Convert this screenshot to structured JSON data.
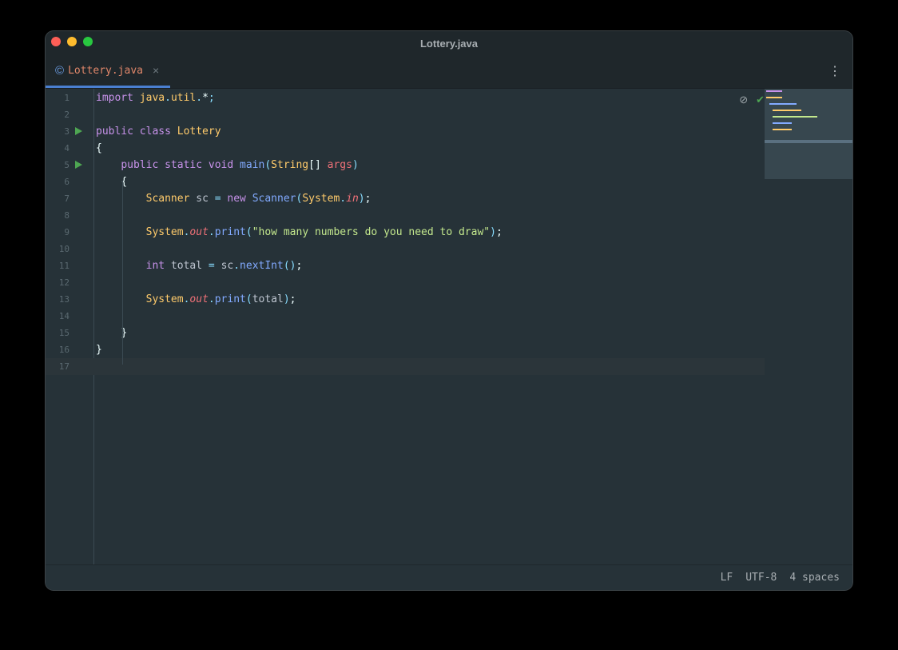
{
  "window": {
    "title": "Lottery.java"
  },
  "tab": {
    "label": "Lottery.java",
    "icon": "class-icon",
    "close": "×",
    "menu": "⋮"
  },
  "lines": [
    {
      "n": "1",
      "t": [
        [
          "kw",
          "import "
        ],
        [
          "cls",
          "java"
        ],
        [
          "pun",
          "."
        ],
        [
          "cls",
          "util"
        ],
        [
          "pun",
          "."
        ],
        [
          "plain",
          "*"
        ],
        [
          "pun",
          ";"
        ]
      ]
    },
    {
      "n": "2",
      "t": []
    },
    {
      "n": "3",
      "run": true,
      "t": [
        [
          "kw",
          "public class "
        ],
        [
          "cls",
          "Lottery"
        ]
      ]
    },
    {
      "n": "4",
      "t": [
        [
          "brk",
          "{"
        ]
      ]
    },
    {
      "n": "5",
      "run": true,
      "t": [
        [
          "plain",
          "    "
        ],
        [
          "kw",
          "public static void "
        ],
        [
          "fn",
          "main"
        ],
        [
          "pun",
          "("
        ],
        [
          "cls",
          "String"
        ],
        [
          "brk",
          "[] "
        ],
        [
          "param",
          "args"
        ],
        [
          "pun",
          ")"
        ]
      ]
    },
    {
      "n": "6",
      "t": [
        [
          "plain",
          "    "
        ],
        [
          "brk",
          "{"
        ]
      ]
    },
    {
      "n": "7",
      "t": [
        [
          "plain",
          "        "
        ],
        [
          "cls",
          "Scanner "
        ],
        [
          "var",
          "sc "
        ],
        [
          "pun",
          "= "
        ],
        [
          "kw",
          "new "
        ],
        [
          "fn",
          "Scanner"
        ],
        [
          "pun",
          "("
        ],
        [
          "cls",
          "System"
        ],
        [
          "pun",
          "."
        ],
        [
          "fld",
          "in"
        ],
        [
          "pun",
          ")"
        ],
        [
          "brk",
          ";"
        ]
      ]
    },
    {
      "n": "8",
      "t": []
    },
    {
      "n": "9",
      "t": [
        [
          "plain",
          "        "
        ],
        [
          "cls",
          "System"
        ],
        [
          "pun",
          "."
        ],
        [
          "fld",
          "out"
        ],
        [
          "pun",
          "."
        ],
        [
          "fn",
          "print"
        ],
        [
          "pun",
          "("
        ],
        [
          "str",
          "\"how many numbers do you need to draw\""
        ],
        [
          "pun",
          ")"
        ],
        [
          "brk",
          ";"
        ]
      ]
    },
    {
      "n": "10",
      "t": []
    },
    {
      "n": "11",
      "t": [
        [
          "plain",
          "        "
        ],
        [
          "kw",
          "int "
        ],
        [
          "var",
          "total "
        ],
        [
          "pun",
          "= "
        ],
        [
          "var",
          "sc"
        ],
        [
          "pun",
          "."
        ],
        [
          "fn",
          "nextInt"
        ],
        [
          "pun",
          "()"
        ],
        [
          "brk",
          ";"
        ]
      ]
    },
    {
      "n": "12",
      "t": []
    },
    {
      "n": "13",
      "t": [
        [
          "plain",
          "        "
        ],
        [
          "cls",
          "System"
        ],
        [
          "pun",
          "."
        ],
        [
          "fld",
          "out"
        ],
        [
          "pun",
          "."
        ],
        [
          "fn",
          "print"
        ],
        [
          "pun",
          "("
        ],
        [
          "var",
          "total"
        ],
        [
          "pun",
          ")"
        ],
        [
          "brk",
          ";"
        ]
      ]
    },
    {
      "n": "14",
      "t": []
    },
    {
      "n": "15",
      "t": [
        [
          "plain",
          "    "
        ],
        [
          "brk",
          "}"
        ]
      ]
    },
    {
      "n": "16",
      "t": [
        [
          "brk",
          "}"
        ]
      ]
    },
    {
      "n": "17",
      "t": [],
      "current": true
    }
  ],
  "status": {
    "line_ending": "LF",
    "encoding": "UTF-8",
    "indent": "4 spaces"
  },
  "icons": {
    "inspect": "eye-crossed-icon",
    "status": "check-icon"
  },
  "colors": {
    "keyword": "#c792ea",
    "class": "#ffcb6b",
    "function": "#82aaff",
    "string": "#c3e88d",
    "field": "#f07178",
    "run": "#4ea652",
    "tab_accent": "#4a7fd0"
  }
}
